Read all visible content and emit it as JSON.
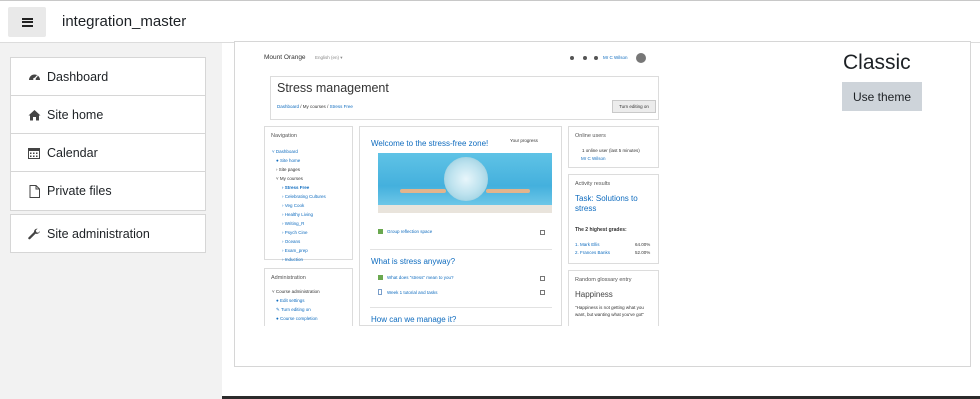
{
  "navbar": {
    "menu_icon": "hamburger-menu-icon",
    "site_name": "integration_master"
  },
  "drawer": {
    "items": [
      {
        "label": "Dashboard",
        "icon": "dashboard-gauge-icon"
      },
      {
        "label": "Site home",
        "icon": "home-icon"
      },
      {
        "label": "Calendar",
        "icon": "calendar-icon"
      },
      {
        "label": "Private files",
        "icon": "file-icon"
      }
    ],
    "admin": {
      "label": "Site administration",
      "icon": "wrench-icon"
    }
  },
  "theme": {
    "name": "Classic",
    "use_button": "Use theme"
  },
  "preview": {
    "brand": "Mount Orange",
    "language": "English (en) ▾",
    "user": "Mr C Wilson",
    "page_title": "Stress management",
    "breadcrumb": [
      "Dashboard",
      "My courses",
      "Stress Free"
    ],
    "edit_button": "Turn editing on",
    "navigation": {
      "title": "Navigation",
      "items": [
        "Dashboard",
        "Site home",
        "Site pages",
        "My courses",
        "Stress Free",
        "Celebrating Cultures",
        "Veg Cook",
        "Healthy Living",
        "Writing_R",
        "Psych Cine",
        "Oceans",
        "Exam_prep",
        "Induction"
      ]
    },
    "administration": {
      "title": "Administration",
      "items": [
        "Course administration",
        "Edit settings",
        "Turn editing on",
        "Course completion"
      ]
    },
    "welcome": "Welcome to the stress-free zone!",
    "progress": "Your progress",
    "activities": [
      "Group reflection space",
      "What does \"stress\" mean to you?",
      "Week 1 tutorial and tasks"
    ],
    "section2": "What is stress anyway?",
    "section3": "How can we manage it?",
    "online_users": {
      "title": "Online users",
      "summary": "1 online user (last 5 minutes)",
      "user": "Mr C Wilson"
    },
    "activity_results": {
      "title": "Activity results",
      "task": "Task: Solutions to stress",
      "highest": "The 2 highest grades:",
      "rows": [
        {
          "name": "1. Mark Ellis",
          "score": "64.00%"
        },
        {
          "name": "2. Frances Banks",
          "score": "52.00%"
        }
      ]
    },
    "glossary": {
      "title": "Random glossary entry",
      "word": "Happiness",
      "quote": "\"Happiness is not getting what you want, but wanting what you've got\""
    }
  }
}
